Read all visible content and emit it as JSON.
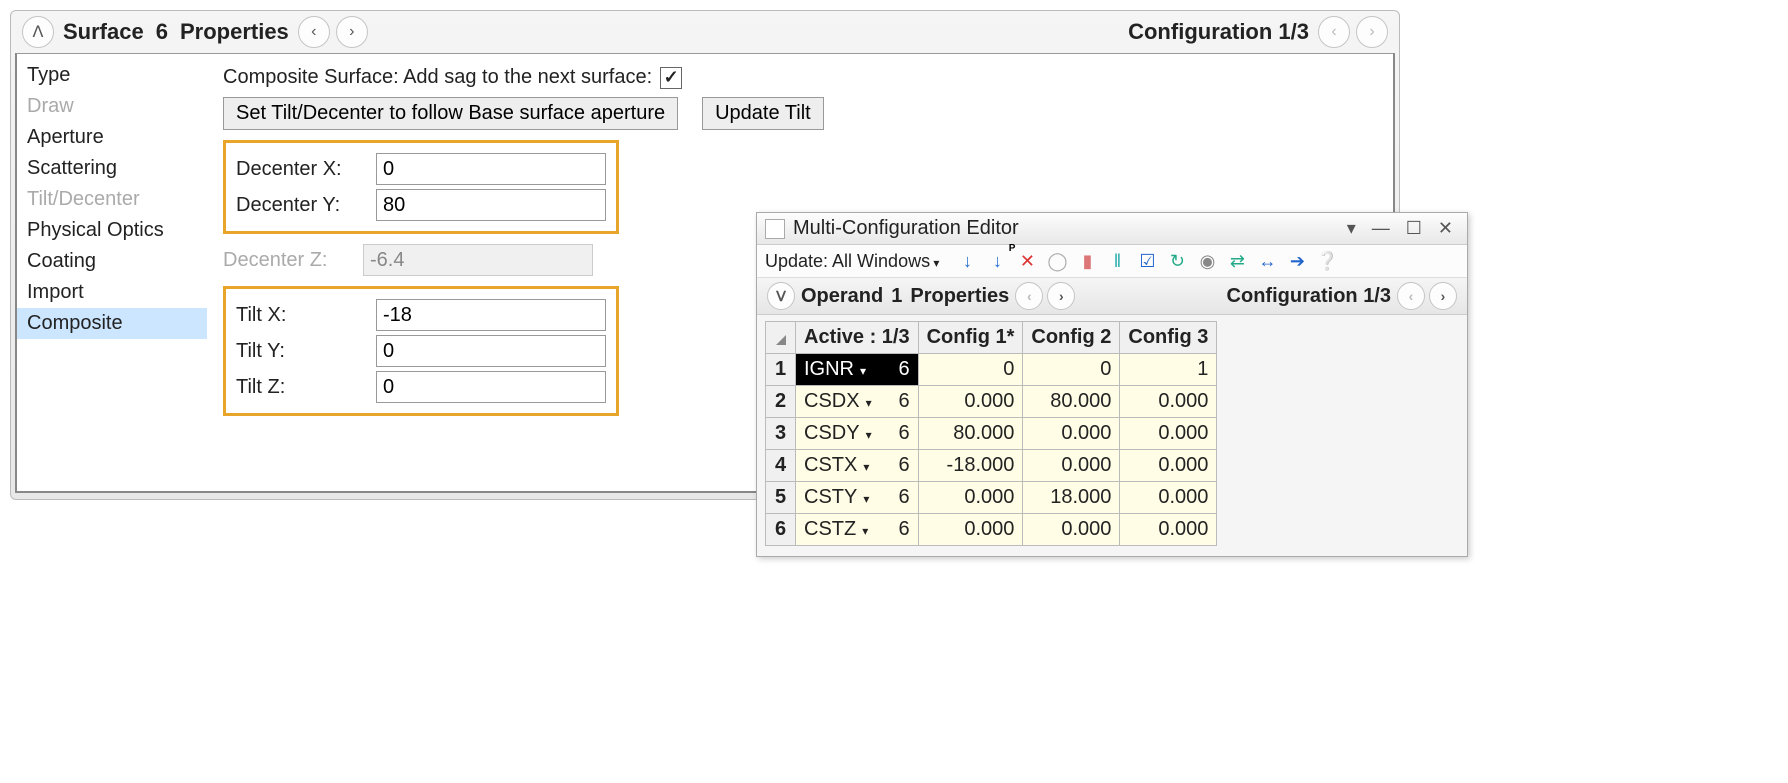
{
  "props": {
    "title_surface": "Surface",
    "title_num": "6",
    "title_props": "Properties",
    "config_label": "Configuration 1/3",
    "sidebar": [
      {
        "label": "Type",
        "disabled": false,
        "selected": false
      },
      {
        "label": "Draw",
        "disabled": true,
        "selected": false
      },
      {
        "label": "Aperture",
        "disabled": false,
        "selected": false
      },
      {
        "label": "Scattering",
        "disabled": false,
        "selected": false
      },
      {
        "label": "Tilt/Decenter",
        "disabled": true,
        "selected": false
      },
      {
        "label": "Physical Optics",
        "disabled": false,
        "selected": false
      },
      {
        "label": "Coating",
        "disabled": false,
        "selected": false
      },
      {
        "label": "Import",
        "disabled": false,
        "selected": false
      },
      {
        "label": "Composite",
        "disabled": false,
        "selected": true
      }
    ],
    "composite_label": "Composite Surface: Add sag to the next surface:",
    "btn_set_tilt": "Set Tilt/Decenter to follow Base surface aperture",
    "btn_update_tilt": "Update Tilt",
    "decenter": {
      "x_label": "Decenter X:",
      "x_value": "0",
      "y_label": "Decenter Y:",
      "y_value": "80",
      "z_label": "Decenter Z:",
      "z_value": "-6.4"
    },
    "tilt": {
      "x_label": "Tilt X:",
      "x_value": "-18",
      "y_label": "Tilt Y:",
      "y_value": "0",
      "z_label": "Tilt Z:",
      "z_value": "0"
    }
  },
  "mce": {
    "title": "Multi-Configuration Editor",
    "update_label": "Update: All Windows",
    "sub_operand_label": "Operand",
    "sub_operand_num": "1",
    "sub_operand_props": "Properties",
    "sub_config_label": "Configuration 1/3",
    "headers": {
      "active": "Active : 1/3",
      "c1": "Config 1*",
      "c2": "Config 2",
      "c3": "Config 3"
    },
    "rows": [
      {
        "n": "1",
        "op": "IGNR",
        "surf": "6",
        "c1": "0",
        "c2": "0",
        "c3": "1",
        "selected": true
      },
      {
        "n": "2",
        "op": "CSDX",
        "surf": "6",
        "c1": "0.000",
        "c2": "80.000",
        "c3": "0.000"
      },
      {
        "n": "3",
        "op": "CSDY",
        "surf": "6",
        "c1": "80.000",
        "c2": "0.000",
        "c3": "0.000"
      },
      {
        "n": "4",
        "op": "CSTX",
        "surf": "6",
        "c1": "-18.000",
        "c2": "0.000",
        "c3": "0.000"
      },
      {
        "n": "5",
        "op": "CSTY",
        "surf": "6",
        "c1": "0.000",
        "c2": "18.000",
        "c3": "0.000"
      },
      {
        "n": "6",
        "op": "CSTZ",
        "surf": "6",
        "c1": "0.000",
        "c2": "0.000",
        "c3": "0.000"
      }
    ]
  }
}
